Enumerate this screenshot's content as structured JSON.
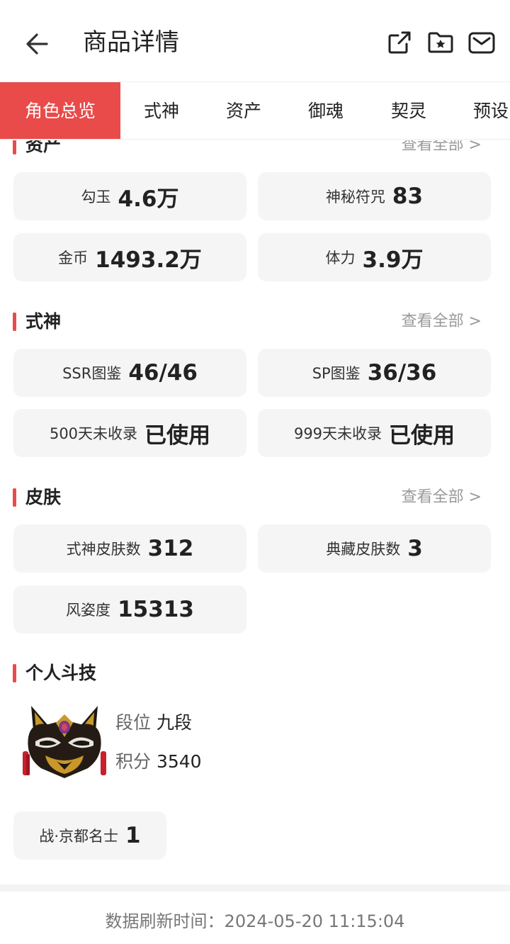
{
  "header": {
    "title": "商品详情",
    "icons": [
      "back-arrow-icon",
      "share-icon",
      "folder-star-icon",
      "mail-icon"
    ]
  },
  "tabs": [
    {
      "label": "角色总览",
      "active": true
    },
    {
      "label": "式神",
      "active": false
    },
    {
      "label": "资产",
      "active": false
    },
    {
      "label": "御魂",
      "active": false
    },
    {
      "label": "契灵",
      "active": false
    },
    {
      "label": "预设",
      "active": false
    }
  ],
  "sections": {
    "assets": {
      "title": "资产",
      "view_all": "查看全部 >",
      "items": [
        {
          "label": "勾玉",
          "value": "4.6万"
        },
        {
          "label": "神秘符咒",
          "value": "83"
        },
        {
          "label": "金币",
          "value": "1493.2万"
        },
        {
          "label": "体力",
          "value": "3.9万"
        }
      ]
    },
    "shikigami": {
      "title": "式神",
      "view_all": "查看全部 >",
      "items": [
        {
          "label": "SSR图鉴",
          "value": "46/46"
        },
        {
          "label": "SP图鉴",
          "value": "36/36"
        },
        {
          "label": "500天未收录",
          "value": "已使用"
        },
        {
          "label": "999天未收录",
          "value": "已使用"
        }
      ]
    },
    "skins": {
      "title": "皮肤",
      "view_all": "查看全部 >",
      "items": [
        {
          "label": "式神皮肤数",
          "value": "312"
        },
        {
          "label": "典藏皮肤数",
          "value": "3"
        },
        {
          "label": "风姿度",
          "value": "15313"
        }
      ]
    },
    "arena": {
      "title": "个人斗技",
      "rank_label": "段位",
      "rank_value": "九段",
      "score_label": "积分",
      "score_value": "3540",
      "badge": {
        "label": "战·京都名士",
        "value": "1"
      }
    }
  },
  "footer": {
    "refresh_text": "数据刷新时间：2024-05-20 11:15:04"
  },
  "colors": {
    "accent": "#e84b4a",
    "card_bg": "#f5f5f5",
    "muted_text": "#9a9a9a"
  }
}
